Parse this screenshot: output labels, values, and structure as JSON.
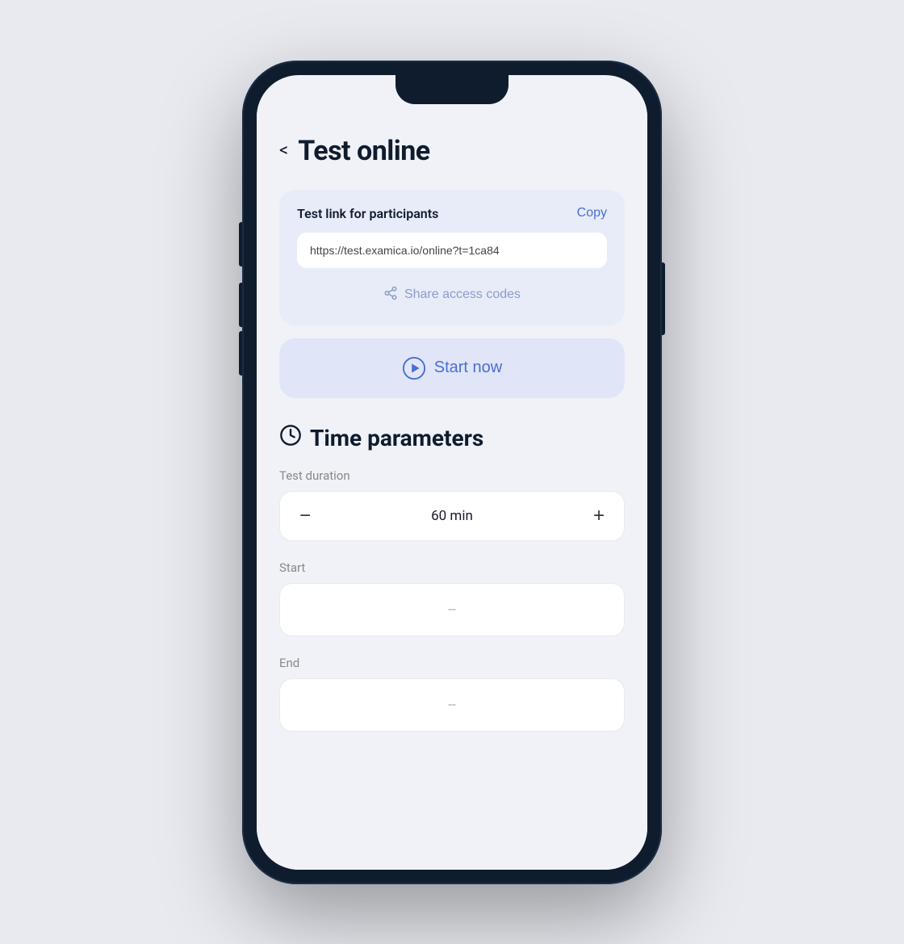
{
  "page": {
    "title": "Test online",
    "back_label": "<"
  },
  "link_card": {
    "label": "Test link for participants",
    "copy_label": "Copy",
    "url": "https://test.examica.io/online?t=1ca84",
    "share_codes_label": "Share access codes"
  },
  "start_now": {
    "label": "Start now"
  },
  "time_parameters": {
    "title": "Time parameters",
    "duration_label": "Test duration",
    "duration_value": "60 min",
    "start_label": "Start",
    "start_value": "--",
    "end_label": "End",
    "end_value": "--",
    "minus_label": "−",
    "plus_label": "+"
  },
  "colors": {
    "accent": "#4a6fd4",
    "muted": "#8a9cc8",
    "card_bg": "#e8ecf8",
    "button_bg": "#e0e5f7"
  }
}
